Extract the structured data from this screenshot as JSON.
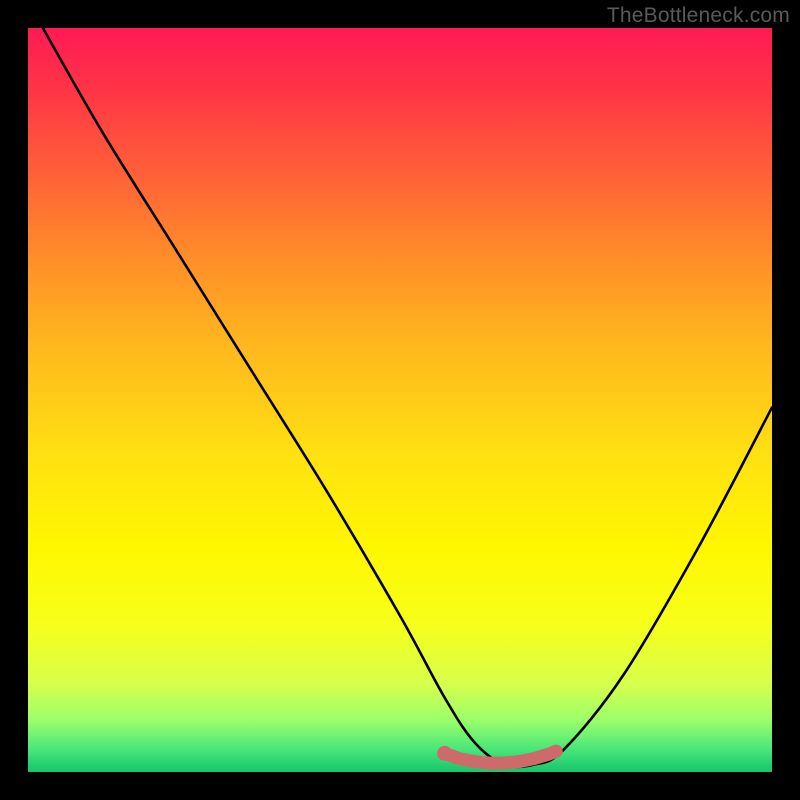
{
  "attribution": "TheBottleneck.com",
  "colors": {
    "curve_stroke": "#000000",
    "marker_fill": "#cf6a6a",
    "marker_stroke": "#cf6a6a"
  },
  "chart_data": {
    "type": "line",
    "title": "",
    "xlabel": "",
    "ylabel": "",
    "xlim": [
      0,
      100
    ],
    "ylim": [
      0,
      100
    ],
    "grid": false,
    "series": [
      {
        "name": "bottleneck-curve",
        "x": [
          2,
          10,
          20,
          30,
          40,
          50,
          56,
          60,
          64,
          68,
          72,
          80,
          90,
          100
        ],
        "y": [
          100,
          86,
          70,
          54,
          38,
          21,
          10,
          4,
          1,
          1,
          3,
          13,
          30,
          49
        ]
      }
    ],
    "markers": {
      "name": "highlight-range",
      "x": [
        56,
        58,
        60,
        62,
        64,
        66,
        68,
        70,
        71
      ],
      "y": [
        2.5,
        1.8,
        1.4,
        1.2,
        1.2,
        1.4,
        1.8,
        2.4,
        2.8
      ]
    }
  }
}
